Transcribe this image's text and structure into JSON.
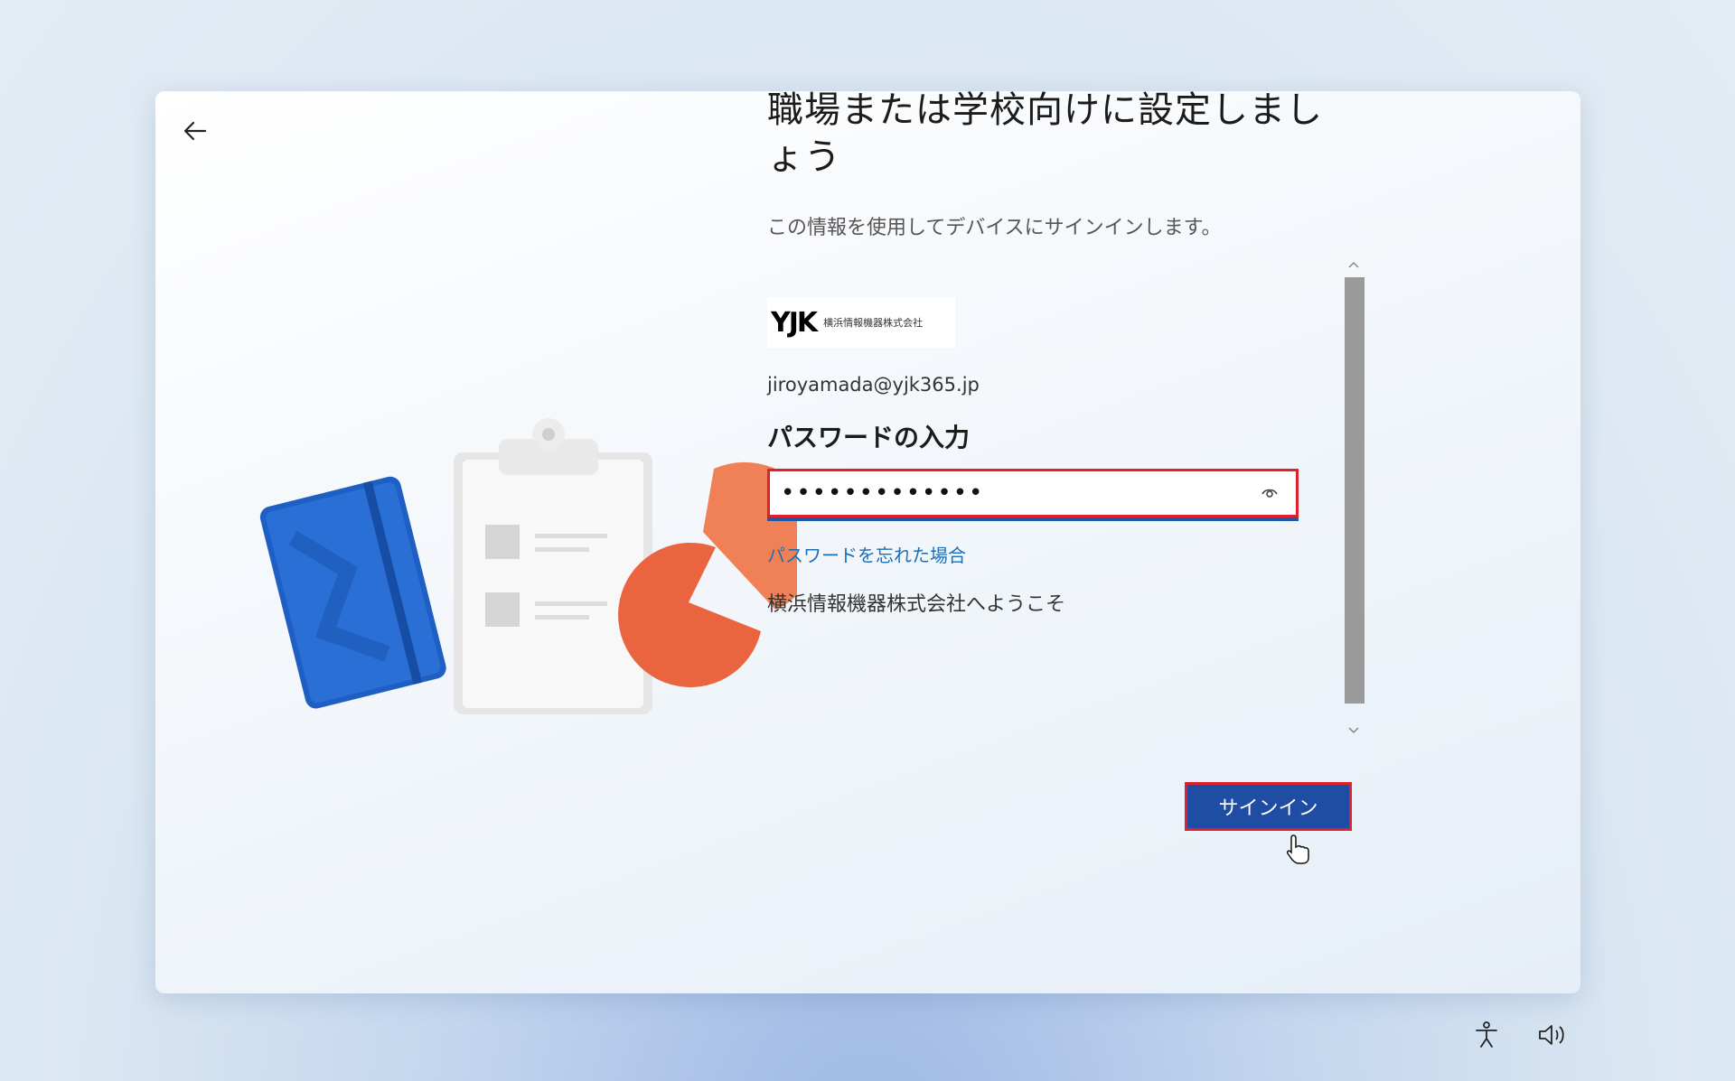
{
  "header": {
    "title": "職場または学校向けに設定しましょう",
    "subtitle": "この情報を使用してデバイスにサインインします。"
  },
  "org": {
    "logo_mark": "YJK",
    "logo_name": "横浜情報機器株式会社"
  },
  "account": {
    "email": "jiroyamada@yjk365.jp"
  },
  "password": {
    "heading": "パスワードの入力",
    "value": "•••••••••••••",
    "forgot_link": "パスワードを忘れた場合"
  },
  "welcome_text": "横浜情報機器株式会社へようこそ",
  "actions": {
    "signin_label": "サインイン"
  },
  "icons": {
    "back": "back-arrow-icon",
    "eye": "eye-icon",
    "accessibility": "accessibility-icon",
    "volume": "volume-icon"
  },
  "colors": {
    "primary": "#1e4da3",
    "highlight": "#e0202d",
    "link": "#1a6fb8"
  }
}
